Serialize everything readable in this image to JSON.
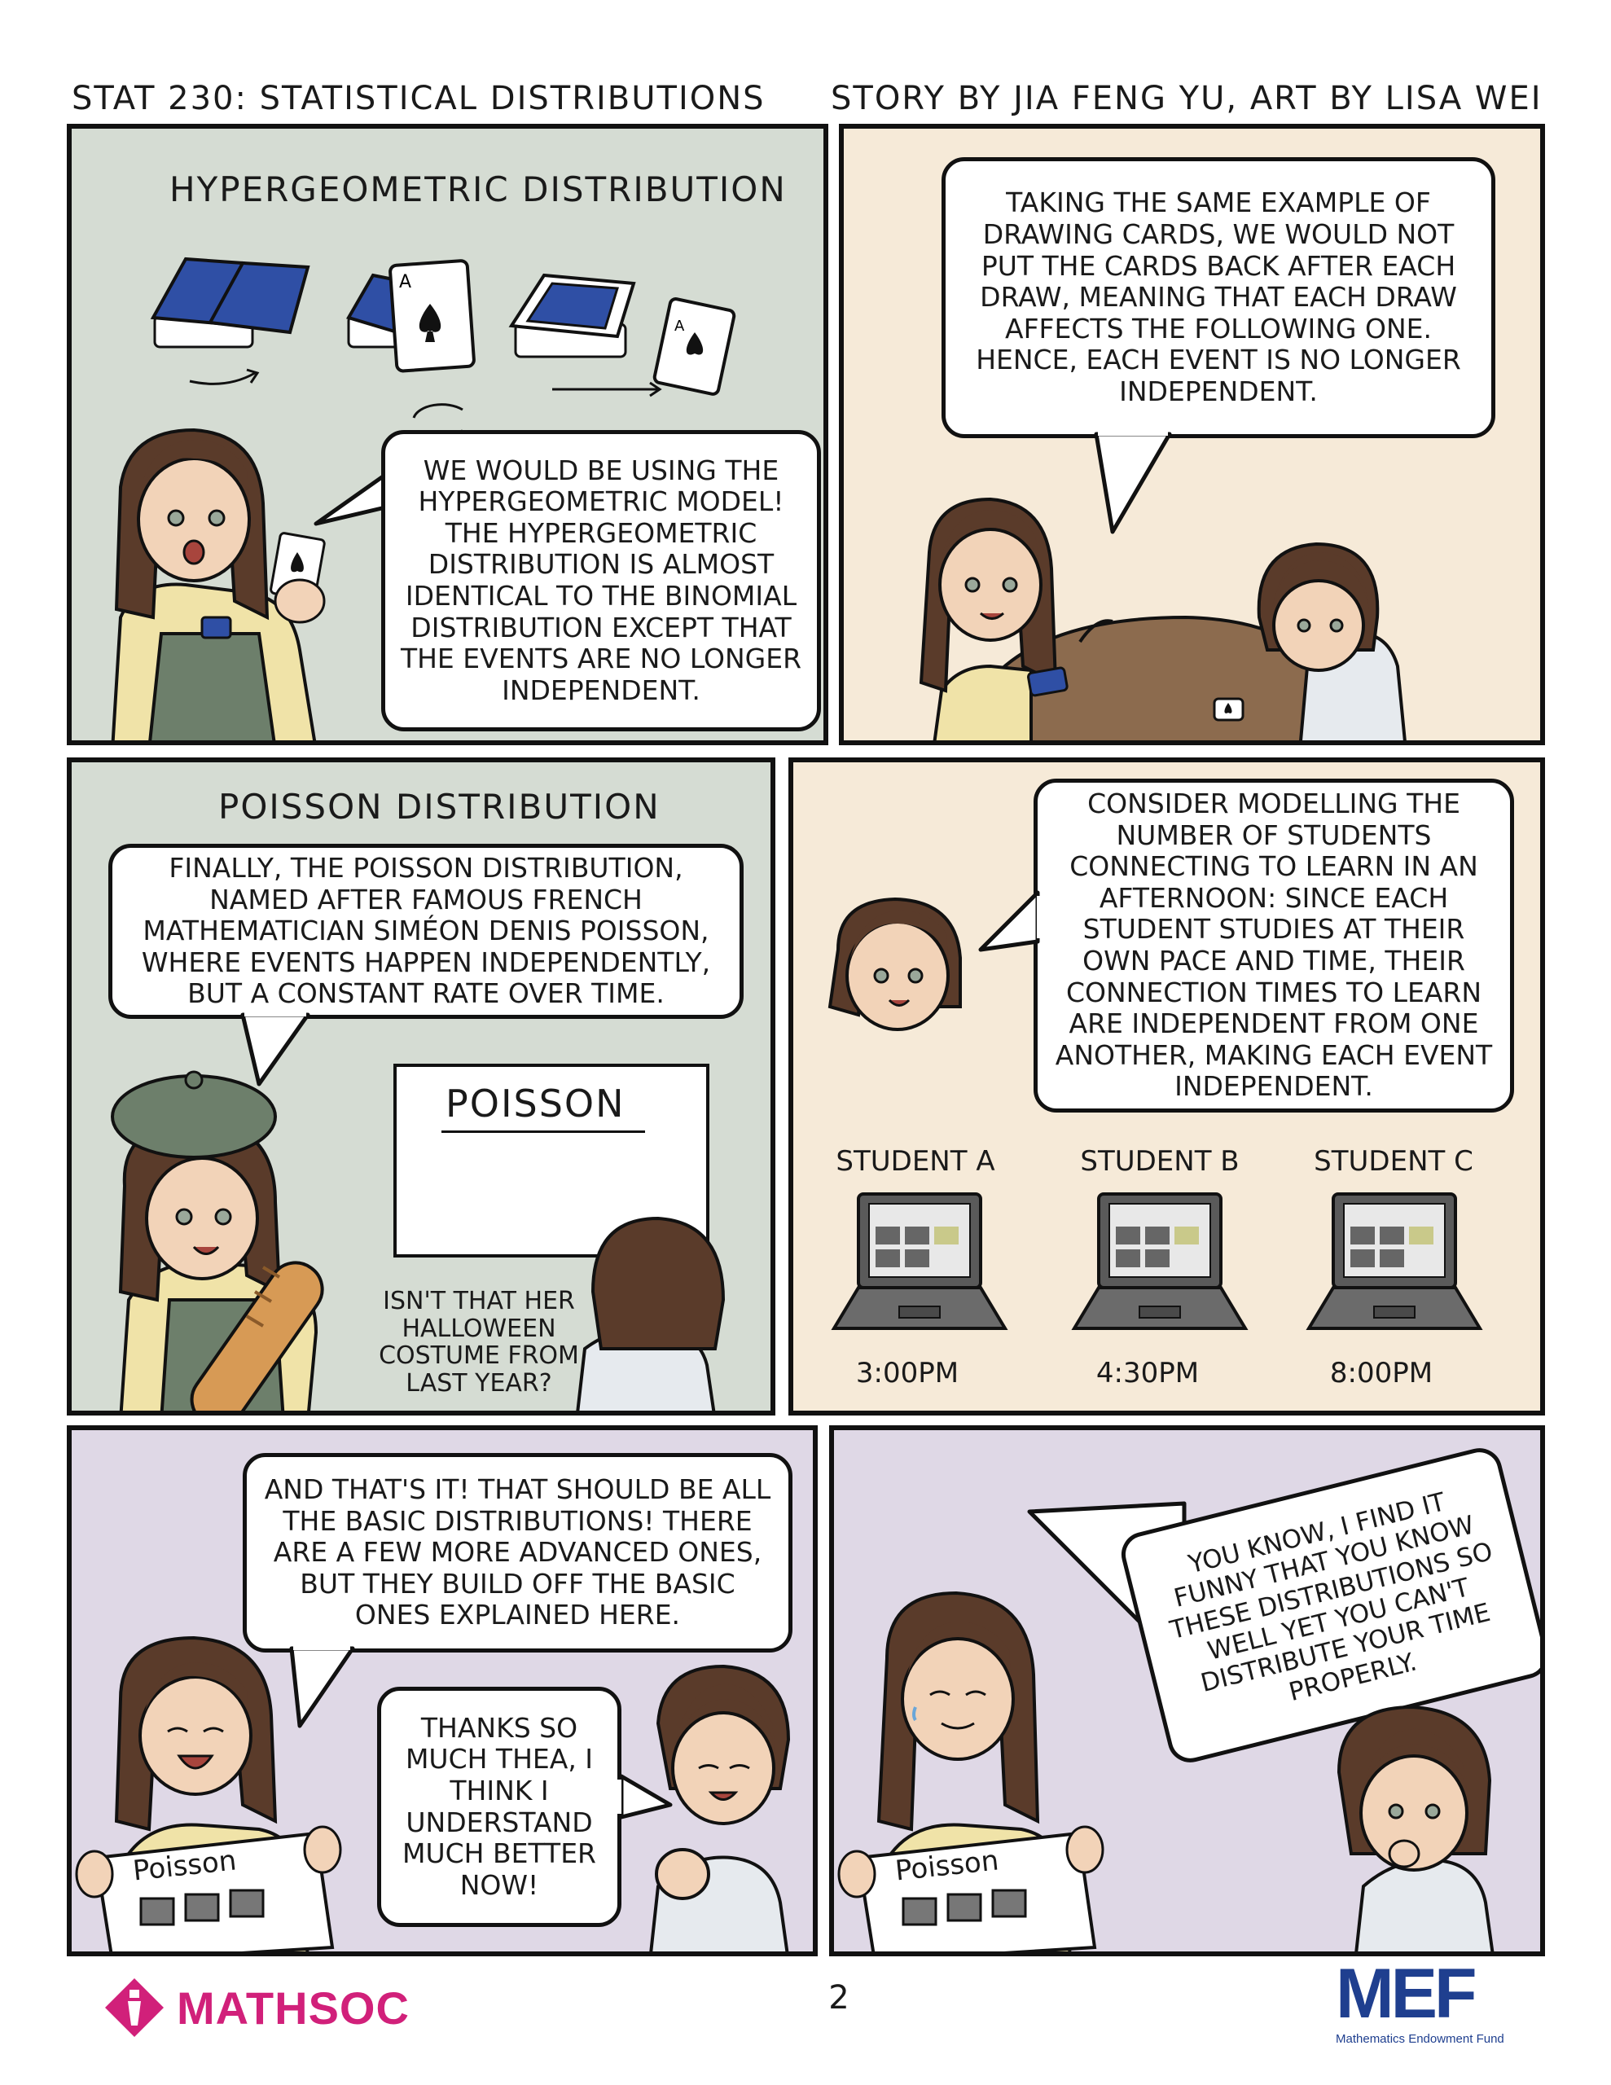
{
  "header": {
    "left": "STAT 230: STATISTICAL DISTRIBUTIONS",
    "right": "STORY BY JIA FENG YU, ART BY LISA WEI"
  },
  "panels": {
    "p1": {
      "title": "HYPERGEOMETRIC DISTRIBUTION",
      "speech": "WE WOULD BE USING THE HYPERGEOMETRIC MODEL! THE HYPERGEOMETRIC DISTRIBUTION IS ALMOST IDENTICAL TO THE BINOMIAL DISTRIBUTION EXCEPT THAT THE EVENTS ARE NO LONGER INDEPENDENT."
    },
    "p2": {
      "speech": "TAKING THE SAME EXAMPLE OF DRAWING CARDS, WE WOULD NOT PUT THE CARDS BACK AFTER EACH DRAW, MEANING THAT EACH DRAW AFFECTS THE FOLLOWING ONE. HENCE, EACH EVENT IS NO LONGER INDEPENDENT."
    },
    "p3": {
      "title": "POISSON DISTRIBUTION",
      "speech": "FINALLY, THE POISSON DISTRIBUTION, NAMED AFTER FAMOUS FRENCH MATHEMATICIAN SIMÉON DENIS POISSON, WHERE EVENTS HAPPEN INDEPENDENTLY, BUT A CONSTANT RATE OVER TIME.",
      "board": "POISSON",
      "aside": "ISN'T THAT HER HALLOWEEN COSTUME FROM LAST YEAR?"
    },
    "p4": {
      "speech": "CONSIDER MODELLING THE NUMBER OF STUDENTS CONNECTING TO LEARN IN AN AFTERNOON: SINCE EACH STUDENT STUDIES AT THEIR OWN PACE AND TIME, THEIR CONNECTION TIMES TO LEARN ARE INDEPENDENT FROM ONE ANOTHER, MAKING EACH EVENT INDEPENDENT.",
      "students": [
        {
          "name": "STUDENT A",
          "time": "3:00PM"
        },
        {
          "name": "STUDENT B",
          "time": "4:30PM"
        },
        {
          "name": "STUDENT C",
          "time": "8:00PM"
        }
      ]
    },
    "p5": {
      "speech": "AND THAT'S IT! THAT SHOULD BE ALL THE BASIC DISTRIBUTIONS! THERE ARE A FEW MORE ADVANCED ONES, BUT THEY BUILD OFF THE BASIC ONES EXPLAINED HERE.",
      "reply": "THANKS SO MUCH THEA, I THINK I UNDERSTAND MUCH BETTER NOW!",
      "sign": "Poisson"
    },
    "p6": {
      "speech": "YOU KNOW, I FIND IT FUNNY THAT YOU KNOW THESE DISTRIBUTIONS SO WELL YET YOU CAN'T DISTRIBUTE YOUR TIME PROPERLY.",
      "sign": "Poisson"
    }
  },
  "footer": {
    "left_logo": "MATHSOC",
    "page": "2",
    "right_logo": "MEF",
    "right_logo_sub": "Mathematics Endowment Fund"
  },
  "colors": {
    "green_panel": "#d5dcd3",
    "tan_panel": "#f6ead8",
    "purple_panel": "#dfd8e6",
    "hair": "#5a3b2a",
    "skin": "#f2d3b8",
    "card_blue": "#2f4fa5",
    "mathsoc_pink": "#d1207a",
    "mef_blue": "#1f3f8f"
  }
}
